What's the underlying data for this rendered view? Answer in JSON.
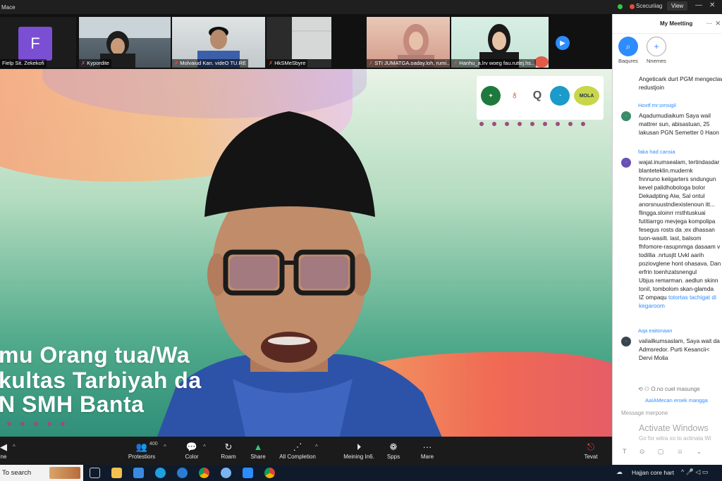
{
  "titlebar": {
    "app_title": "Mace",
    "recording_label": "Scecuriiag",
    "view_label": "View",
    "minimize": "—",
    "close": "✕"
  },
  "gallery": {
    "tiles": [
      {
        "name": "Fielp Sit. Zekekofi",
        "initial": "F"
      },
      {
        "name": "Kypordite"
      },
      {
        "name": "Molvaiud Kan. videO TU.RE"
      },
      {
        "name": "HkSMeSbyre"
      },
      {
        "name": "STI JUMATGA.oaday.loh, rumi..."
      },
      {
        "name": "Hanhu_a.lrv woeg fau.ruttej.hs.."
      }
    ],
    "next_icon": "▶"
  },
  "main_video": {
    "overlay_lines": [
      "mu Orang tua/Wa",
      "kultas Tarbiyah da",
      "N SMH Banta"
    ],
    "logo_text": "MOLA"
  },
  "toolbar": {
    "buttons": [
      {
        "label": "Protestiors",
        "icon": "participants-icon",
        "glyph": "👥",
        "badge": "400"
      },
      {
        "label": "Color",
        "icon": "chat-icon",
        "glyph": "💬"
      },
      {
        "label": "Roam",
        "icon": "refresh-icon",
        "glyph": "↻"
      },
      {
        "label": "Share",
        "icon": "share-screen-icon",
        "glyph": "▲"
      },
      {
        "label": "All Completion",
        "icon": "share-node-icon",
        "glyph": "⋰"
      },
      {
        "label": "Meining In6.",
        "icon": "record-icon",
        "glyph": "⏵"
      },
      {
        "label": "Spps",
        "icon": "apps-icon",
        "glyph": "❁"
      },
      {
        "label": "Mare",
        "icon": "more-icon",
        "glyph": "···"
      },
      {
        "label": "Tevat",
        "icon": "leave-icon",
        "glyph": "⎋"
      }
    ],
    "left_label": "ne"
  },
  "chat": {
    "title": "My Meetting",
    "tabs": [
      {
        "label": "Baqures",
        "glyph": "⌕"
      },
      {
        "label": "Nnemes",
        "glyph": "+"
      }
    ],
    "messages": [
      {
        "sender": "",
        "text": "Angeticark durt PGM mengeclaw\nredustjoin",
        "avatar_color": ""
      },
      {
        "sender": "Hoxtf mr:omsigil",
        "text": "Aqadumudiaikum Saya wail\nmattrer sun, abisastuan, 25\nlakusan PGN Semetter  0 Haon",
        "avatar_color": "#3a8c6a"
      },
      {
        "sender": "faka had cansia",
        "text": "wajal.inumsealam, tertindasdar\nblanteteklin.mudernk\nfnnnuno keiigarters sndungun\nkevel palidhobologa bolor\nDekadpting Aiw, Sal ontul\nanorsnuustndiexistenoun itt...\nflingga.sloinrr rrsthtuskuai\nfutitiarrgo mevjega kompolipa\nfesegus rosts da ;ex dhassan\ntuon-wasilt. last, balsom\nfhfomore-rasupnmga dasaam v\ntodillia .nrtusjtt Uvkl aarih\npoziovglene hont ohasava. Dan\nerfrin toenhzatsnengul\nUbjus remarman. aedlun skinn\ntonil, tombolom skan-glamda\nIZ ompaqu⁠",
        "link_text": "totortas tachigat di\nkegaroom",
        "avatar_color": "#6b4fb5"
      },
      {
        "sender": "Aqa eaitonaan",
        "text": "vailailkumsaslam, Saya wait da\nAdmsredor. Purti Kesancii<\nDervi Molia",
        "avatar_color": "#4a5a6a"
      }
    ],
    "reaction_row": "⟲  ⚇  O.no cuel masunge",
    "info_line": "AaIAMecan eroek mangga",
    "input_placeholder": "Message merpone",
    "activate_title": "Activate Windows",
    "activate_sub": "Go for witra xo to actinata Wi",
    "tools": "T ⊙ ▢ ☺ ⌄"
  },
  "taskbar": {
    "search_text": "To search",
    "tray_text": "Hajjan core hart",
    "tray_icons": "^  🎤  ◁ ▭"
  }
}
